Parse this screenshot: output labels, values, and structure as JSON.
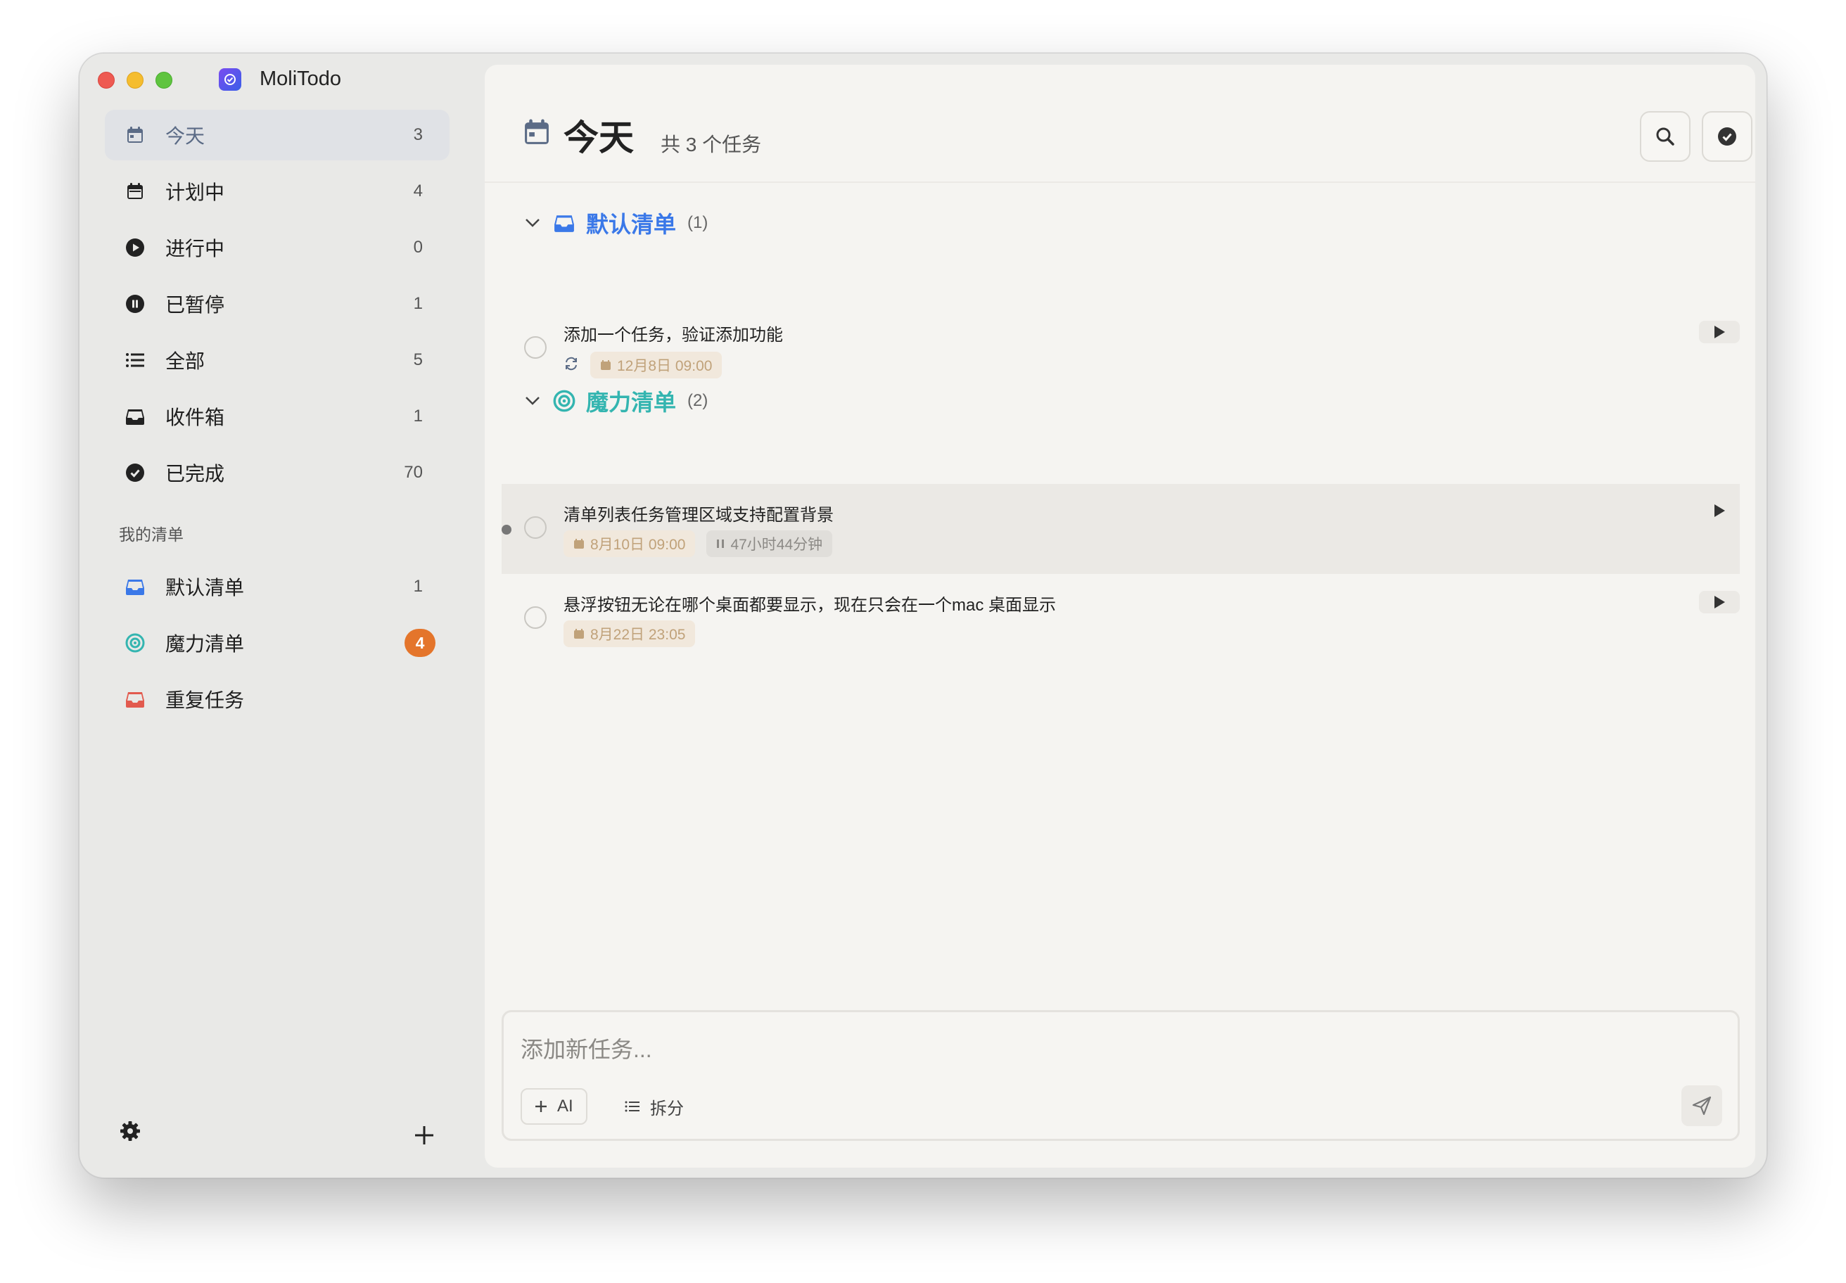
{
  "app": {
    "title": "MoliTodo"
  },
  "sidebar": {
    "nav": [
      {
        "label": "今天",
        "count": "3"
      },
      {
        "label": "计划中",
        "count": "4"
      },
      {
        "label": "进行中",
        "count": "0"
      },
      {
        "label": "已暂停",
        "count": "1"
      },
      {
        "label": "全部",
        "count": "5"
      },
      {
        "label": "收件箱",
        "count": "1"
      },
      {
        "label": "已完成",
        "count": "70"
      }
    ],
    "section_title": "我的清单",
    "lists": [
      {
        "label": "默认清单",
        "count": "1",
        "color": "#3a78e8"
      },
      {
        "label": "魔力清单",
        "badge": "4",
        "color": "#34b5b0"
      },
      {
        "label": "重复任务",
        "count": "",
        "color": "#e25a4e"
      }
    ]
  },
  "header": {
    "title": "今天",
    "subtitle": "共 3 个任务"
  },
  "groups": [
    {
      "name": "默认清单",
      "count": "(1)",
      "color": "#3a78e8",
      "tasks": [
        {
          "title": "添加一个任务，验证添加功能",
          "date": "12月8日 09:00",
          "repeat": true
        }
      ]
    },
    {
      "name": "魔力清单",
      "count": "(2)",
      "color": "#34b5b0",
      "tasks": [
        {
          "title": "清单列表任务管理区域支持配置背景",
          "date": "8月10日 09:00",
          "duration": "47小时44分钟"
        },
        {
          "title": "悬浮按钮无论在哪个桌面都要显示，现在只会在一个mac 桌面显示",
          "date": "8月22日 23:05"
        }
      ]
    }
  ],
  "composer": {
    "placeholder": "添加新任务...",
    "ai_label": "AI",
    "split_label": "拆分"
  },
  "colors": {
    "accent_orange": "#e4752b",
    "date_chip_text": "#c0a27a"
  }
}
